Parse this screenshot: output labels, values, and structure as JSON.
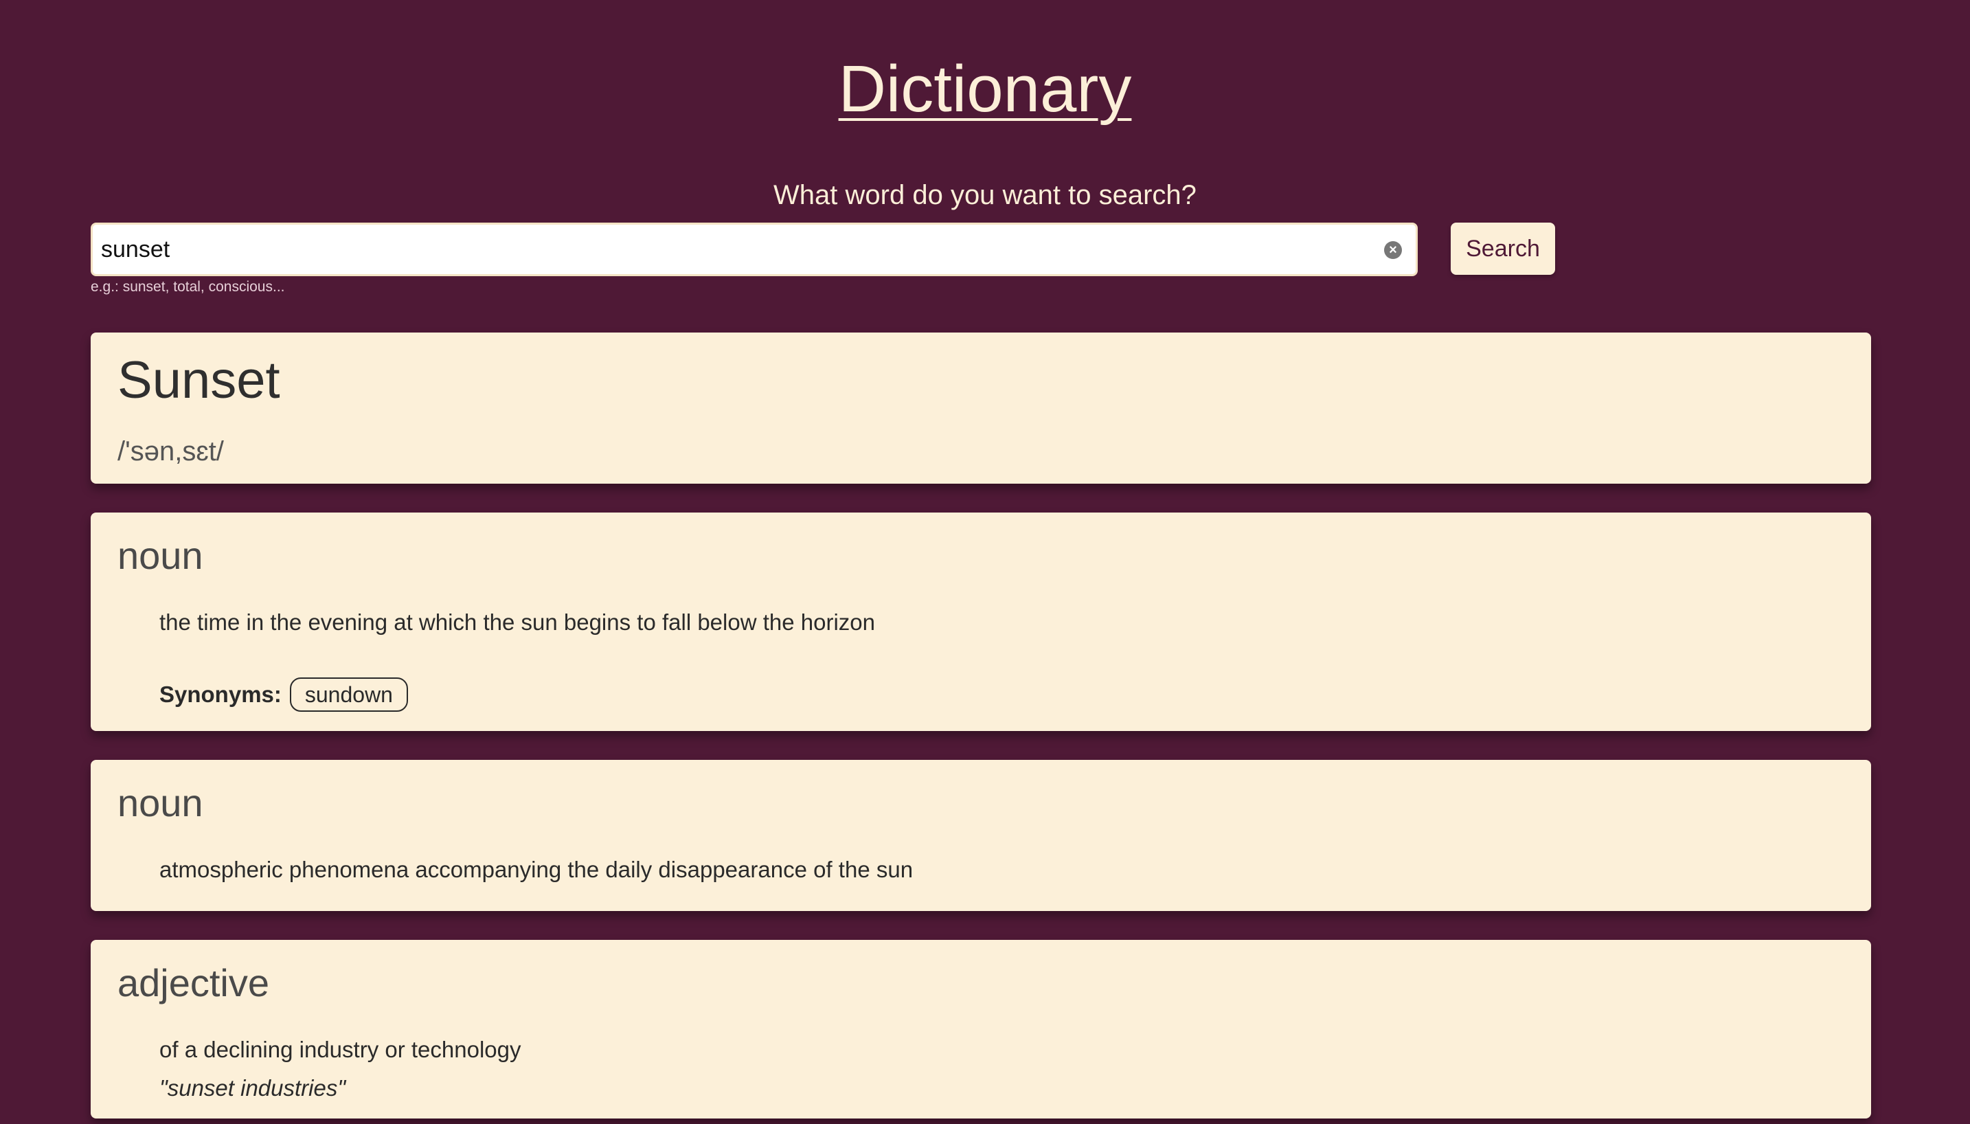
{
  "header": {
    "title": "Dictionary",
    "prompt": "What word do you want to search?"
  },
  "search": {
    "value": "sunset",
    "hint": "e.g.: sunset, total, conscious...",
    "button_label": "Search",
    "clear_icon": "clear-circle-icon"
  },
  "result": {
    "word": "Sunset",
    "phonetic": "/'sən,sɛt/",
    "meanings": [
      {
        "part_of_speech": "noun",
        "definition": "the time in the evening at which the sun begins to fall below the horizon",
        "synonyms_label": "Synonyms:",
        "synonyms": [
          "sundown"
        ]
      },
      {
        "part_of_speech": "noun",
        "definition": "atmospheric phenomena accompanying the daily disappearance of the sun"
      },
      {
        "part_of_speech": "adjective",
        "definition": "of a declining industry or technology",
        "example": "\"sunset industries\""
      }
    ]
  },
  "colors": {
    "background": "#4f1936",
    "card": "#fcf0d9",
    "accent_text": "#fcefd8"
  }
}
